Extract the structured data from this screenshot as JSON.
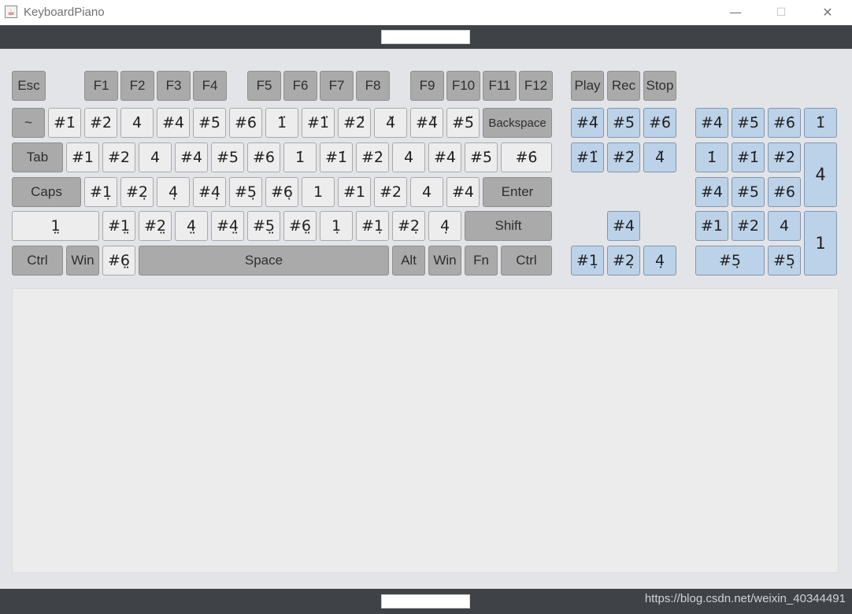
{
  "window": {
    "title": "KeyboardPiano",
    "minimize": "—",
    "maximize": "☐",
    "close": "✕",
    "app_icon": "java-cup-icon"
  },
  "watermark": "https://blog.csdn.net/weixin_40344491",
  "keys": {
    "esc": "Esc",
    "fn_row": [
      "F1",
      "F2",
      "F3",
      "F4",
      "F5",
      "F6",
      "F7",
      "F8",
      "F9",
      "F10",
      "F11",
      "F12"
    ],
    "play": "Play",
    "rec": "Rec",
    "stop": "Stop",
    "tilde": "~",
    "row1": [
      "#1̇",
      "#2̇",
      "4̇",
      "#4̇",
      "#5̇",
      "#6̇",
      "1̈",
      "#1̈",
      "#2̈",
      "4̈",
      "#4̈",
      "#5̈"
    ],
    "backspace": "Backspace",
    "tab": "Tab",
    "row2": [
      "#1",
      "#2",
      "4",
      "#4",
      "#5",
      "#6",
      "1̇",
      "#1̇",
      "#2̇",
      "4̇",
      "#4̇",
      "#5̇",
      "#6̇"
    ],
    "caps": "Caps",
    "row3": [
      "#1̣",
      "#2̣",
      "4̣",
      "#4̣",
      "#5̣",
      "#6̣",
      "1",
      "#1",
      "#2",
      "4",
      "#4"
    ],
    "enter": "Enter",
    "lshift_note": "1̤",
    "row4": [
      "#1̤",
      "#2̤",
      "4̤",
      "#4̤",
      "#5̤",
      "#6̤",
      "1̣",
      "#1̣",
      "#2̣",
      "4̣"
    ],
    "shift": "Shift",
    "ctrl_left": "Ctrl",
    "win_left": "Win",
    "note_6": "#6̤",
    "space": "Space",
    "alt": "Alt",
    "win_right": "Win",
    "fn": "Fn",
    "ctrl_right": "Ctrl",
    "nav_top": [
      "#4̈",
      "#5̈",
      "#6̈"
    ],
    "nav_mid": [
      "#1̈",
      "#2̈",
      "4̈"
    ],
    "arrow_up": "#4",
    "arrow_row": [
      "#1̣",
      "#2̣",
      "4̣"
    ],
    "numpad": {
      "r1": [
        "#4̇",
        "#5̇",
        "#6̇",
        "1̈"
      ],
      "r2": [
        "1̇",
        "#1̇",
        "#2̇"
      ],
      "plus": "4̇",
      "r3": [
        "#4",
        "#5",
        "#6"
      ],
      "r4": [
        "#1",
        "#2",
        "4"
      ],
      "enter": "1",
      "zero": "#5̣",
      "dot": "#5̣"
    }
  }
}
